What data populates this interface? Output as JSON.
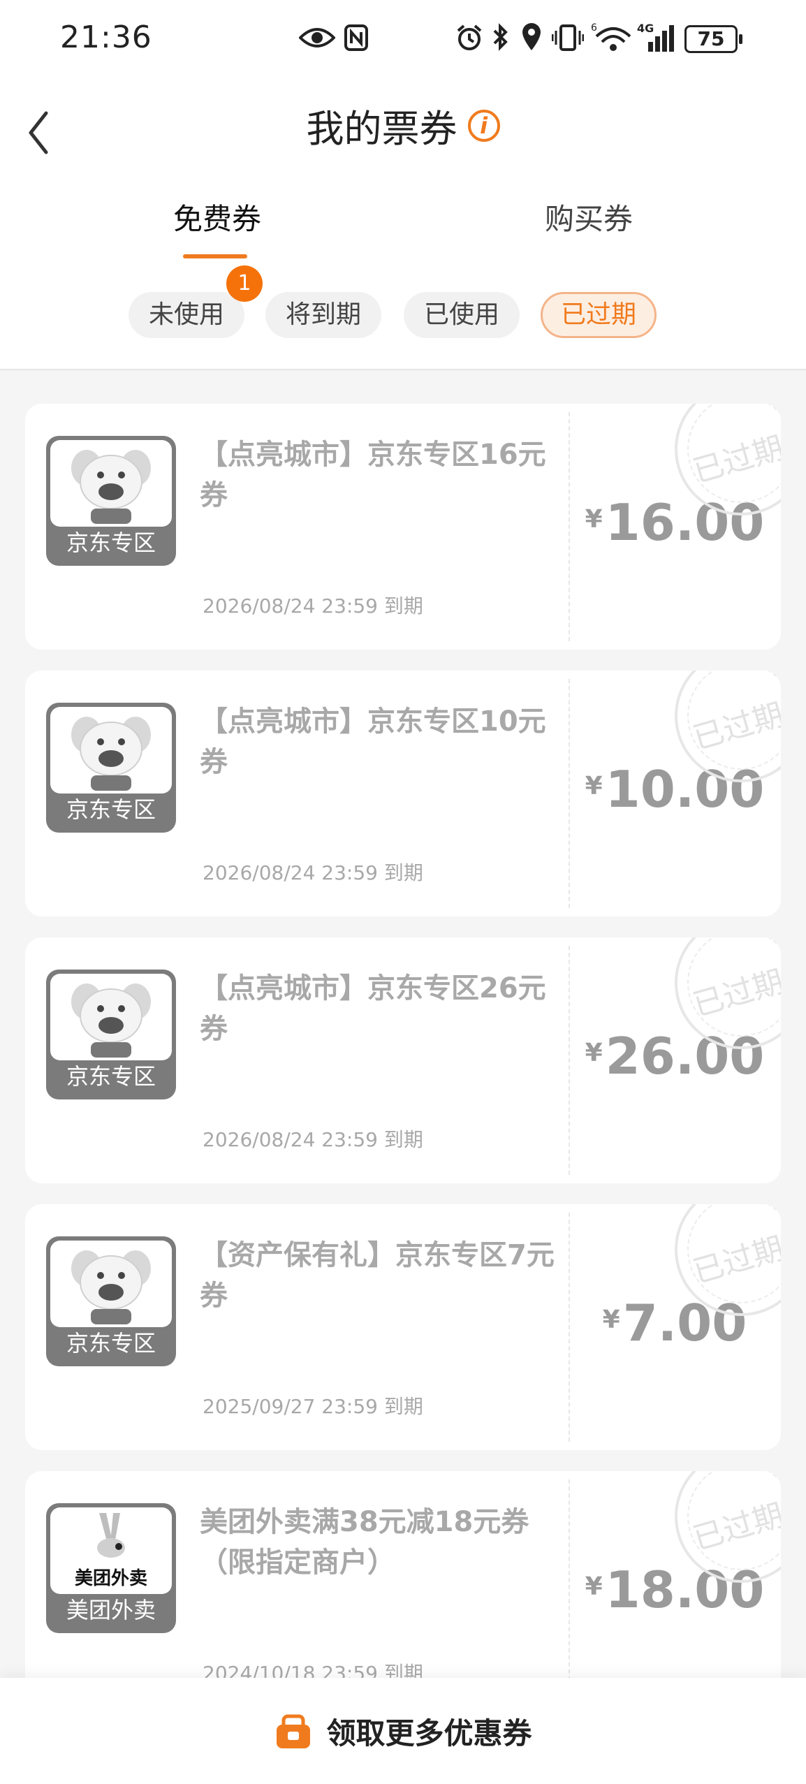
{
  "status_bar": {
    "time": "21:36",
    "battery": "75",
    "icons": [
      "eye-icon",
      "nfc-icon",
      "alarm-icon",
      "bluetooth-icon",
      "location-icon",
      "vibrate-icon",
      "wifi-icon",
      "signal-4g-icon"
    ]
  },
  "header": {
    "title": "我的票券",
    "info_icon": "i"
  },
  "tabs": [
    {
      "label": "免费券",
      "active": true
    },
    {
      "label": "购买券",
      "active": false
    }
  ],
  "filters": [
    {
      "label": "未使用",
      "badge": "1"
    },
    {
      "label": "将到期"
    },
    {
      "label": "已使用"
    },
    {
      "label": "已过期",
      "active": true
    }
  ],
  "coupons": [
    {
      "title": "【点亮城市】京东专区16元券",
      "expire": "2026/08/24 23:59 到期",
      "currency": "¥",
      "amount": "16.00",
      "logo_label": "京东专区",
      "logo_type": "jd-dog",
      "stamp": "已过期"
    },
    {
      "title": "【点亮城市】京东专区10元券",
      "expire": "2026/08/24 23:59 到期",
      "currency": "¥",
      "amount": "10.00",
      "logo_label": "京东专区",
      "logo_type": "jd-dog",
      "stamp": "已过期"
    },
    {
      "title": "【点亮城市】京东专区26元券",
      "expire": "2026/08/24 23:59 到期",
      "currency": "¥",
      "amount": "26.00",
      "logo_label": "京东专区",
      "logo_type": "jd-dog",
      "stamp": "已过期"
    },
    {
      "title": "【资产保有礼】京东专区7元券",
      "expire": "2025/09/27 23:59 到期",
      "currency": "¥",
      "amount": "7.00",
      "logo_label": "京东专区",
      "logo_type": "jd-dog",
      "stamp": "已过期"
    },
    {
      "title": "美团外卖满38元减18元券（限指定商户）",
      "expire": "2024/10/18 23:59 到期",
      "currency": "¥",
      "amount": "18.00",
      "logo_label": "美团外卖",
      "logo_brand": "美团外卖",
      "logo_type": "meituan",
      "stamp": "已过期"
    }
  ],
  "bottom": {
    "label": "领取更多优惠券",
    "icon": "coupon-bag-icon"
  },
  "colors": {
    "accent": "#f07b1e",
    "badge": "#f5720a",
    "muted_text": "#a8a8a8"
  }
}
